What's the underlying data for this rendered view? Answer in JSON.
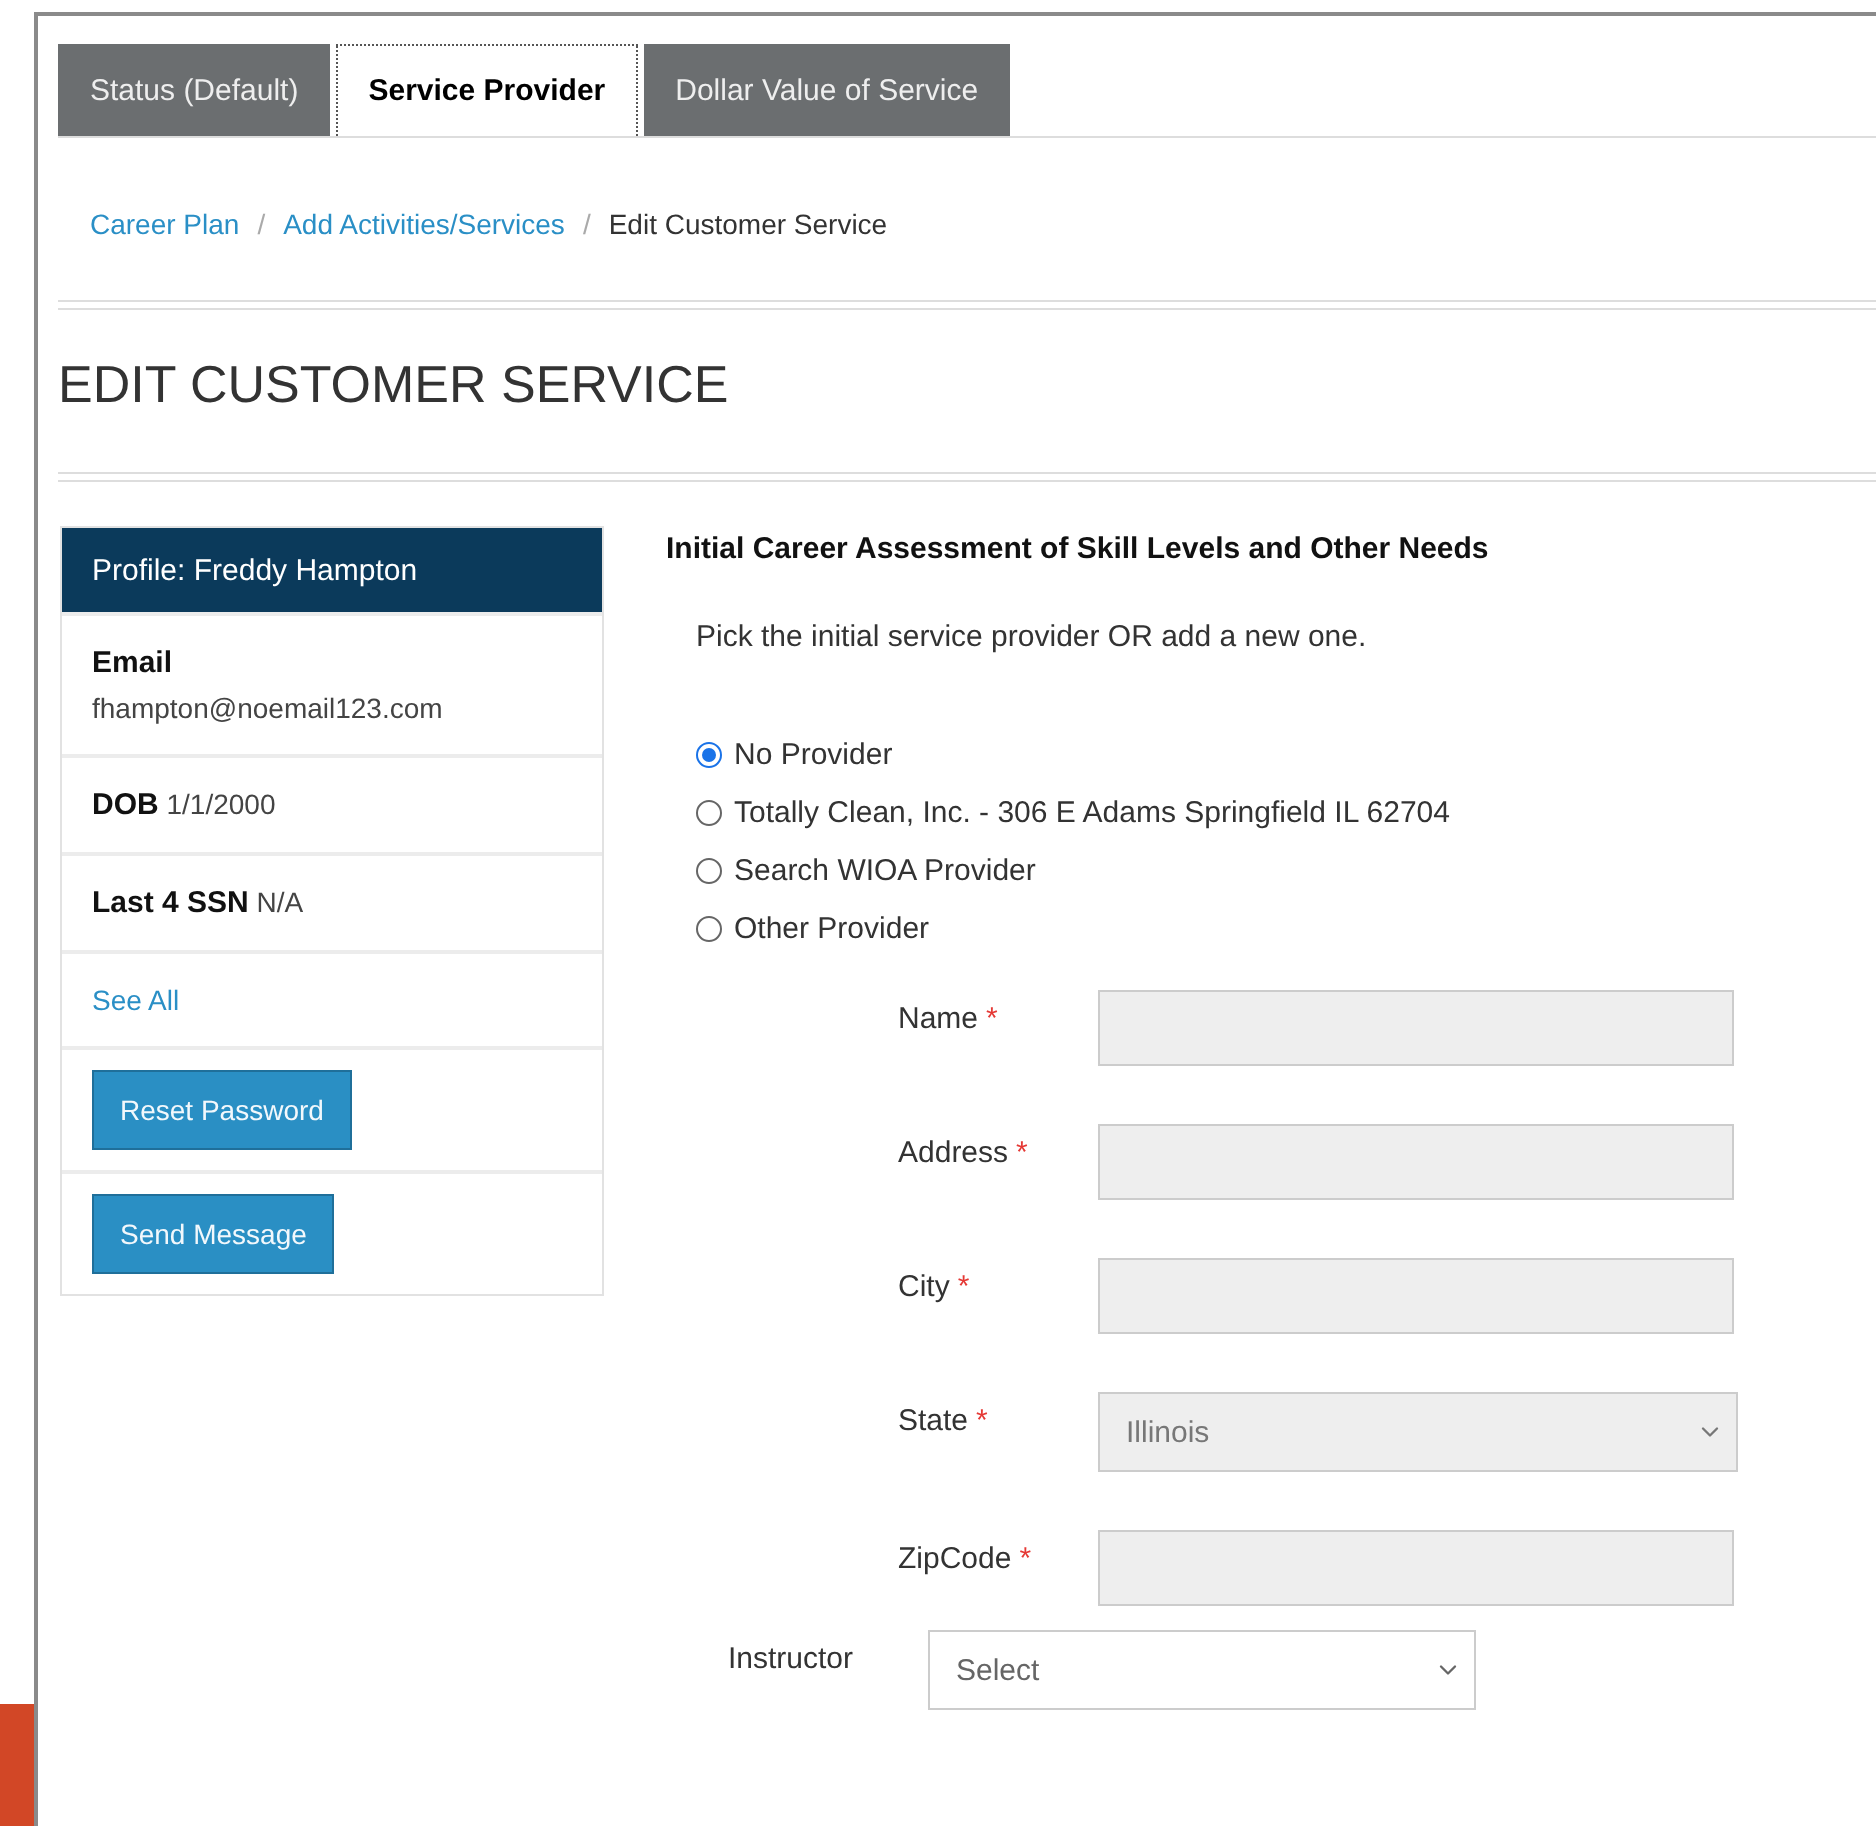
{
  "tabs": [
    {
      "label": "Status (Default)",
      "selected": false
    },
    {
      "label": "Service Provider",
      "selected": true
    },
    {
      "label": "Dollar Value of Service",
      "selected": false
    }
  ],
  "breadcrumb": [
    {
      "kind": "link",
      "text": "Career Plan"
    },
    {
      "kind": "separator",
      "text": "/"
    },
    {
      "kind": "link",
      "text": "Add Activities/Services"
    },
    {
      "kind": "separator",
      "text": "/"
    },
    {
      "kind": "current",
      "text": "Edit Customer Service"
    }
  ],
  "page_title": "EDIT CUSTOMER SERVICE",
  "profile": {
    "title": "Profile: Freddy Hampton",
    "rows": [
      {
        "kind": "stacked",
        "label": "Email",
        "value": "fhampton@noemail123.com"
      },
      {
        "kind": "inline",
        "label": "DOB",
        "value": "1/1/2000"
      },
      {
        "kind": "inline",
        "label": "Last 4 SSN",
        "value": "N/A"
      },
      {
        "kind": "link",
        "label": "See All"
      },
      {
        "kind": "button",
        "label": "Reset Password"
      },
      {
        "kind": "button",
        "label": "Send Message"
      }
    ]
  },
  "service": {
    "heading": "Initial Career Assessment of Skill Levels and Other Needs",
    "instruction": "Pick the initial service provider OR add a new one.",
    "options": [
      {
        "label": "No Provider",
        "selected": true
      },
      {
        "label": "Totally Clean, Inc. - 306 E Adams Springfield IL 62704",
        "selected": false
      },
      {
        "label": "Search WIOA Provider",
        "selected": false
      },
      {
        "label": "Other Provider",
        "selected": false
      }
    ],
    "fields": [
      {
        "kind": "text",
        "label": "Name",
        "required_mark": "*",
        "disabled": true
      },
      {
        "kind": "text",
        "label": "Address",
        "required_mark": "*",
        "disabled": true
      },
      {
        "kind": "text",
        "label": "City",
        "required_mark": "*",
        "disabled": true
      },
      {
        "kind": "select",
        "label": "State",
        "required_mark": "*",
        "disabled": true,
        "value": "Illinois"
      },
      {
        "kind": "text",
        "label": "ZipCode",
        "required_mark": "*",
        "disabled": true
      }
    ],
    "instructor": {
      "label": "Instructor",
      "placeholder": "Select",
      "disabled": false
    }
  }
}
